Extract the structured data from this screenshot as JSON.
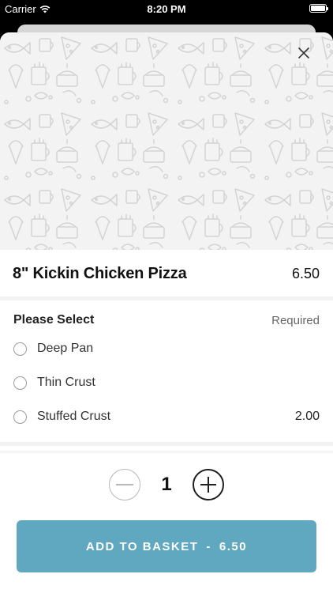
{
  "status_bar": {
    "carrier": "Carrier",
    "time": "8:20 PM",
    "wifi_icon": "wifi-icon",
    "battery_icon": "battery-icon"
  },
  "hero": {
    "pattern": "food-doodle-pattern",
    "close_icon": "close-icon"
  },
  "product": {
    "name": "8\" Kickin Chicken Pizza",
    "price": "6.50"
  },
  "options_section": {
    "title": "Please Select",
    "required_label": "Required",
    "options": [
      {
        "label": "Deep Pan",
        "price": ""
      },
      {
        "label": "Thin Crust",
        "price": ""
      },
      {
        "label": "Stuffed Crust",
        "price": "2.00"
      }
    ]
  },
  "quantity": {
    "value": "1",
    "minus_icon": "minus-icon",
    "plus_icon": "plus-icon"
  },
  "basket_button": {
    "label": "ADD TO BASKET",
    "separator": "-",
    "price": "6.50"
  },
  "colors": {
    "accent": "#5fa8bf",
    "hero_bg": "#f3f3f3",
    "divider": "#f2f2f2"
  }
}
